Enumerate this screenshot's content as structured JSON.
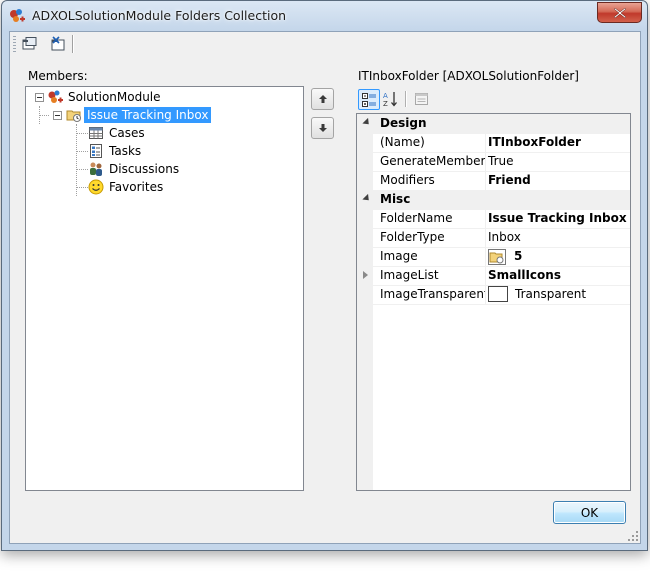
{
  "window": {
    "title": "ADXOLSolutionModule Folders Collection",
    "close_glyph": "✕"
  },
  "toolbar": {
    "add_icon": "add-folder-icon",
    "remove_icon": "remove-folder-icon"
  },
  "members": {
    "label": "Members:",
    "tree": [
      {
        "label": "SolutionModule",
        "icon": "solution-module-icon",
        "expanded": true,
        "level": 0
      },
      {
        "label": "Issue Tracking Inbox",
        "icon": "inbox-folder-icon",
        "expanded": true,
        "level": 1,
        "selected": true
      },
      {
        "label": "Cases",
        "icon": "table-icon",
        "level": 2
      },
      {
        "label": "Tasks",
        "icon": "tasks-icon",
        "level": 2
      },
      {
        "label": "Discussions",
        "icon": "discussions-icon",
        "level": 2
      },
      {
        "label": "Favorites",
        "icon": "smiley-icon",
        "level": 2
      }
    ]
  },
  "properties": {
    "header": "ITInboxFolder [ADXOLSolutionFolder]",
    "categories": [
      {
        "name": "Design",
        "rows": [
          {
            "name": "(Name)",
            "value": "ITInboxFolder",
            "bold": true
          },
          {
            "name": "GenerateMember",
            "value": "True",
            "bold": false
          },
          {
            "name": "Modifiers",
            "value": "Friend",
            "bold": true
          }
        ]
      },
      {
        "name": "Misc",
        "rows": [
          {
            "name": "FolderName",
            "value": "Issue Tracking Inbox",
            "bold": true
          },
          {
            "name": "FolderType",
            "value": "Inbox",
            "bold": false
          },
          {
            "name": "Image",
            "value": "5",
            "bold": true
          },
          {
            "name": "ImageList",
            "value": "SmallIcons",
            "bold": true
          },
          {
            "name": "ImageTransparentColor",
            "value": "Transparent",
            "bold": false
          }
        ]
      }
    ]
  },
  "buttons": {
    "ok": "OK"
  },
  "colors": {
    "selection": "#3399ff",
    "ok_border": "#3c7fb1",
    "close_red": "#c0392b"
  }
}
